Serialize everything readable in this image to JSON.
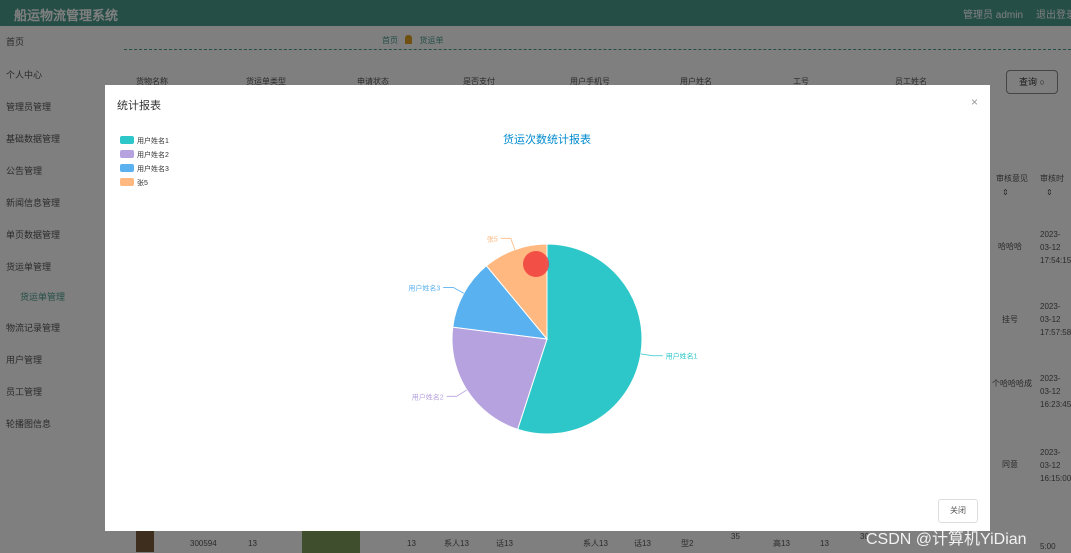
{
  "header": {
    "title": "船运物流管理系统",
    "admin_label": "管理员 admin",
    "logout_label": "退出登录"
  },
  "sidebar": {
    "items": [
      {
        "label": "首页"
      },
      {
        "label": "个人中心"
      },
      {
        "label": "管理员管理"
      },
      {
        "label": "基础数据管理"
      },
      {
        "label": "公告管理"
      },
      {
        "label": "新闻信息管理"
      },
      {
        "label": "单页数据管理"
      },
      {
        "label": "货运单管理"
      },
      {
        "label": "货运单管理"
      },
      {
        "label": "物流记录管理"
      },
      {
        "label": "用户管理"
      },
      {
        "label": "员工管理"
      },
      {
        "label": "轮播图信息"
      }
    ]
  },
  "breadcrumb": {
    "home": "首页",
    "current": "货运单"
  },
  "table": {
    "headers": [
      "货物名称",
      "货运单类型",
      "申请状态",
      "是否支付",
      "用户手机号",
      "用户姓名",
      "工号",
      "员工姓名"
    ],
    "right_headers": [
      "审核意见",
      "审核时"
    ],
    "right_col_text": [
      "哈哈哈",
      "挂号",
      "个哈哈哈成",
      "同意"
    ],
    "right_col_time": [
      "2023-03-12 17:54:15",
      "2023-03-12 17:57:58",
      "2023-03-12 16:23:45",
      "2023-03-12 16:15:00"
    ],
    "bottom_row": [
      "300594",
      "13",
      "13",
      "系人13",
      "话13",
      "系人13",
      "话13",
      "型2",
      "35",
      "高13",
      "13",
      "30",
      "5:00"
    ]
  },
  "search_button": "查询",
  "dialog": {
    "title": "统计报表",
    "close_label": "关闭"
  },
  "watermark": "CSDN @计算机YiDian",
  "chart_data": {
    "type": "pie",
    "title": "货运次数统计报表",
    "legend_position": "top-left",
    "series": [
      {
        "name": "用户姓名1",
        "value": 55,
        "color": "#2ec7c9"
      },
      {
        "name": "用户姓名2",
        "value": 22,
        "color": "#b6a2de"
      },
      {
        "name": "用户姓名3",
        "value": 12,
        "color": "#5ab1ef"
      },
      {
        "name": "张5",
        "value": 11,
        "color": "#ffb980"
      }
    ]
  }
}
